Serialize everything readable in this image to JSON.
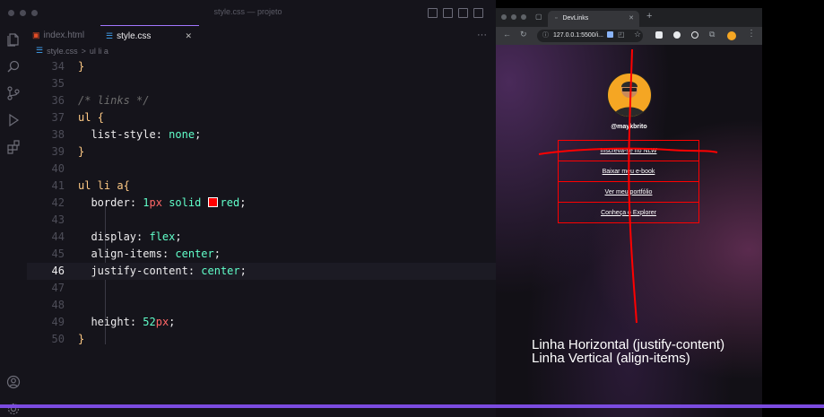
{
  "editor": {
    "window_title": "style.css — projeto",
    "tabs": [
      {
        "label": "index.html",
        "icon": "html-file-icon"
      },
      {
        "label": "style.css",
        "icon": "css-file-icon",
        "close": "✕"
      }
    ],
    "more_actions": "···",
    "breadcrumb": [
      "style.css",
      ">",
      "ul li a"
    ],
    "current_line": 46
  },
  "browser": {
    "tab_title": "DevLinks",
    "tab_close": "✕",
    "new_tab": "+",
    "url": "127.0.0.1:5500/i..."
  },
  "page": {
    "handle": "@maykbrito",
    "links": [
      "Inscreva-se no NLW",
      "Baixar meu e-book",
      "Ver meu portfólio",
      "Conheça o Explorer"
    ]
  },
  "captions": [
    "Linha Horizontal (justify-content)",
    "Linha Vertical (align-items)"
  ],
  "colors": {
    "accent": "#a277ff",
    "annotation": "#ff0000",
    "border": "red"
  }
}
